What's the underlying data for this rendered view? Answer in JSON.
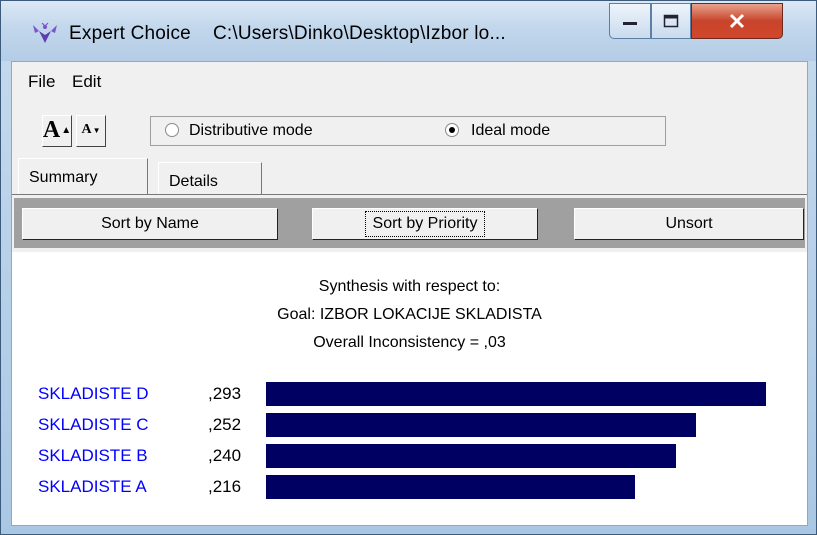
{
  "window": {
    "app_name": "Expert Choice",
    "path": "C:\\Users\\Dinko\\Desktop\\Izbor lo..."
  },
  "menu": {
    "file": "File",
    "edit": "Edit"
  },
  "toolbar": {
    "increase_font": "A",
    "decrease_font": "A",
    "modes": [
      {
        "label": "Distributive mode",
        "checked": false
      },
      {
        "label": "Ideal mode",
        "checked": true
      }
    ]
  },
  "tabs": [
    {
      "label": "Summary",
      "active": true
    },
    {
      "label": "Details",
      "active": false
    }
  ],
  "sort_buttons": {
    "by_name": "Sort by Name",
    "by_priority": "Sort by Priority",
    "unsort": "Unsort"
  },
  "synthesis": {
    "heading": "Synthesis with respect to:",
    "goal": "Goal: IZBOR LOKACIJE SKLADISTA",
    "inconsistency": "Overall Inconsistency = ,03"
  },
  "colors": {
    "bar": "#000062",
    "alt_name": "#0000ff"
  },
  "chart_data": {
    "type": "bar",
    "categories": [
      "SKLADISTE D",
      "SKLADISTE C",
      "SKLADISTE B",
      "SKLADISTE A"
    ],
    "values": [
      0.293,
      0.252,
      0.24,
      0.216
    ],
    "value_labels": [
      ",293",
      ",252",
      ",240",
      ",216"
    ],
    "orientation": "horizontal"
  }
}
